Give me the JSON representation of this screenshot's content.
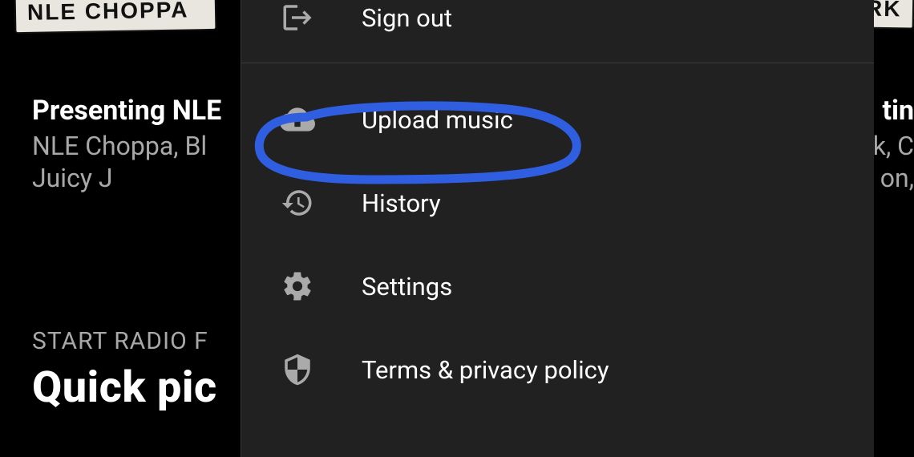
{
  "cards": {
    "left": "NLE CHOPPA",
    "right": "RK"
  },
  "playlists": {
    "left": {
      "title": "Presenting NLE",
      "artists_line1": "NLE Choppa, Bl",
      "artists_line2": "Juicy J"
    },
    "right": {
      "title": "tin",
      "artists_line1": "k, C",
      "artists_line2": "on,"
    }
  },
  "radio_hint": "START RADIO F",
  "quick_picks": "Quick pic",
  "menu": {
    "sign_out": "Sign out",
    "upload_music": "Upload music",
    "history": "History",
    "settings": "Settings",
    "terms": "Terms & privacy policy"
  }
}
